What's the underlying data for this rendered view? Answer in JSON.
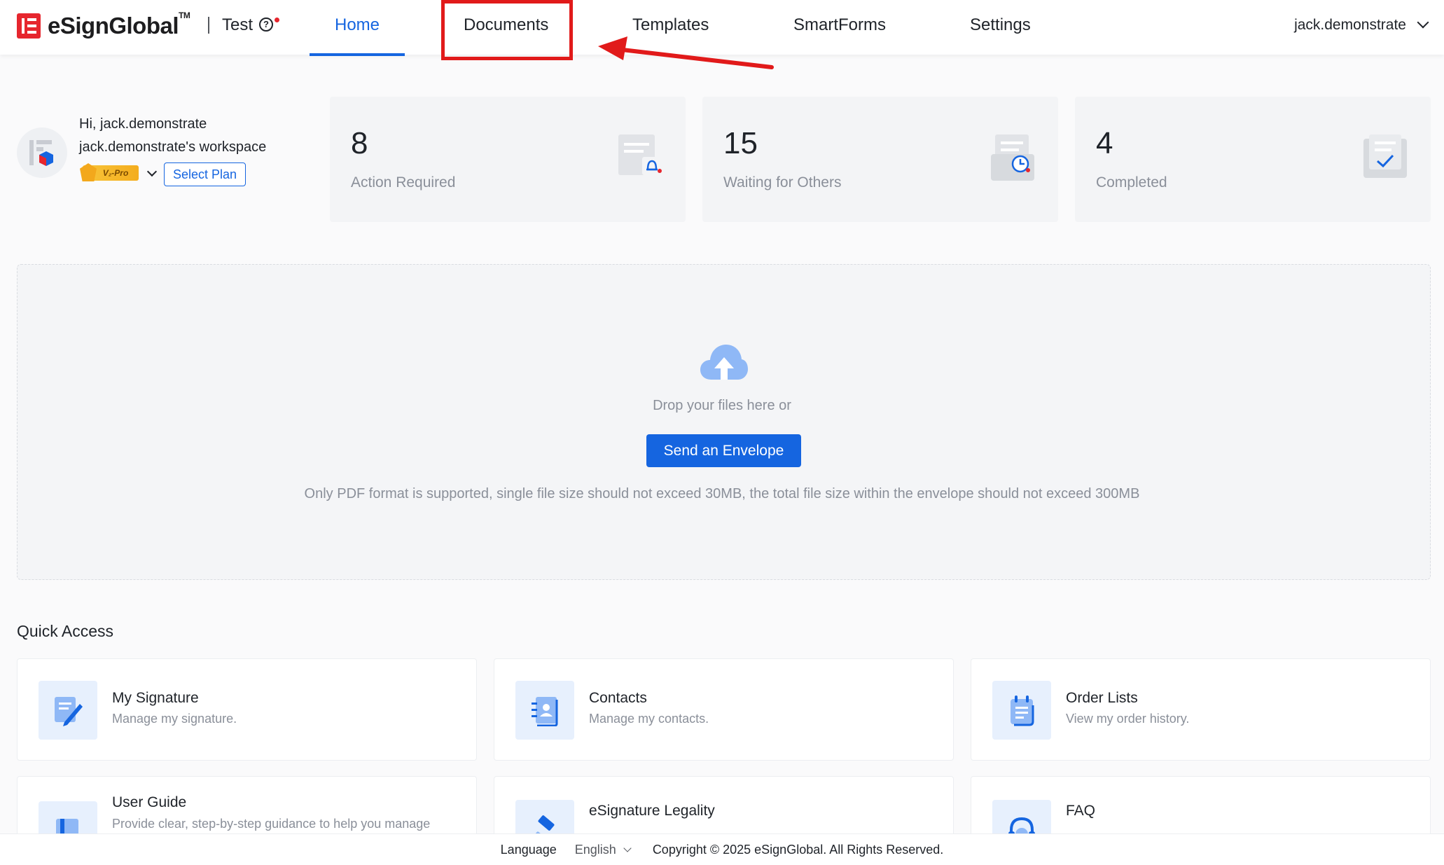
{
  "header": {
    "brand": "eSignGlobal",
    "brand_tm": "TM",
    "workspace": "Test",
    "nav": {
      "home": "Home",
      "documents": "Documents",
      "templates": "Templates",
      "smartforms": "SmartForms",
      "settings": "Settings"
    },
    "user": "jack.demonstrate"
  },
  "profile": {
    "greeting": "Hi, jack.demonstrate",
    "workspace_label": "jack.demonstrate's workspace",
    "plan_badge": "V₂-Pro",
    "select_plan": "Select Plan"
  },
  "stats": [
    {
      "count": "8",
      "label": "Action Required"
    },
    {
      "count": "15",
      "label": "Waiting for Others"
    },
    {
      "count": "4",
      "label": "Completed"
    }
  ],
  "upload": {
    "drop_text": "Drop your files here or",
    "send_button": "Send an Envelope",
    "note": "Only PDF format is supported, single file size should not exceed 30MB, the total file size within the envelope should not exceed 300MB"
  },
  "quick_access": {
    "title": "Quick Access",
    "items": [
      {
        "name": "My Signature",
        "desc": "Manage my signature.",
        "icon": "signature-icon"
      },
      {
        "name": "Contacts",
        "desc": "Manage my contacts.",
        "icon": "contacts-icon"
      },
      {
        "name": "Order Lists",
        "desc": "View my order history.",
        "icon": "order-list-icon"
      },
      {
        "name": "User Guide",
        "desc": "Provide clear, step-by-step guidance to help you manage",
        "icon": "book-icon"
      },
      {
        "name": "eSignature Legality",
        "desc": "",
        "icon": "gavel-icon"
      },
      {
        "name": "FAQ",
        "desc": "",
        "icon": "headset-icon"
      }
    ]
  },
  "footer": {
    "language_label": "Language",
    "language_value": "English",
    "copyright": "Copyright © 2025 eSignGlobal. All Rights Reserved."
  },
  "colors": {
    "brand_red": "#e6262e",
    "primary_blue": "#1565e0",
    "annotation_red": "#e11a1a"
  }
}
